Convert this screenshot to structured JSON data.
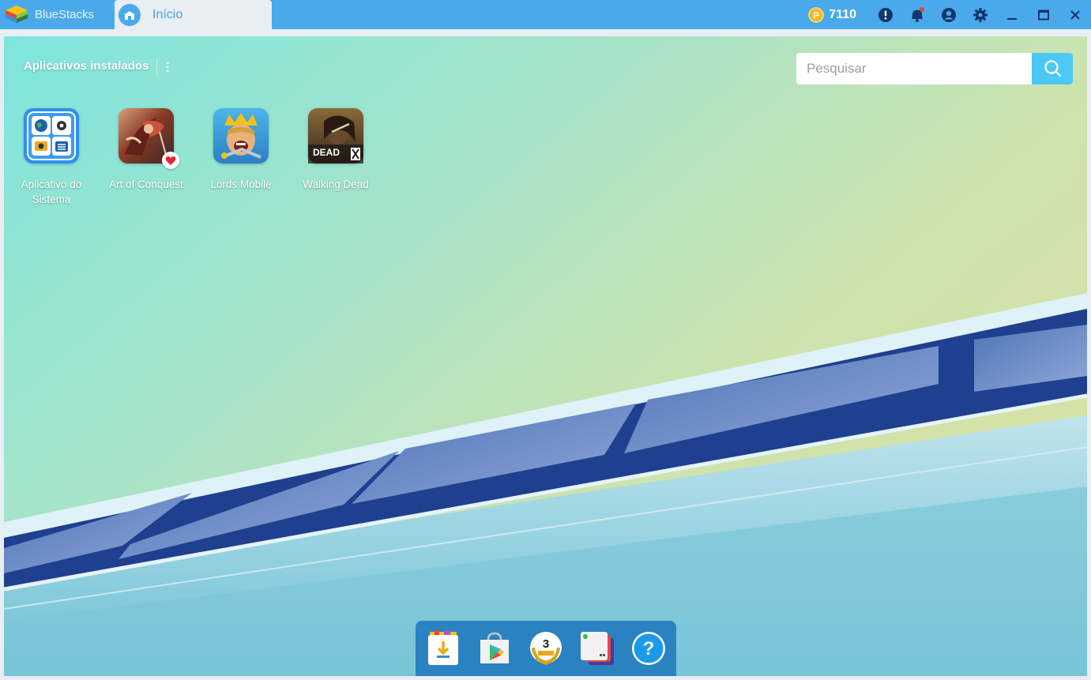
{
  "titlebar": {
    "app_name": "BlueStacks",
    "tab_label": "Início",
    "coins": "7110",
    "colors": {
      "bar": "#4aa9ea",
      "tab_bg": "#e8eef3",
      "coin": "#f5b820"
    }
  },
  "header": {
    "title": "Aplicativos instalados",
    "search_placeholder": "Pesquisar"
  },
  "apps": [
    {
      "label": "Aplicativo do Sistema",
      "icon": "system-apps-icon"
    },
    {
      "label": "Art of Conquest",
      "icon": "art-of-conquest-icon",
      "badge": "heart-icon"
    },
    {
      "label": "Lords Mobile",
      "icon": "lords-mobile-icon"
    },
    {
      "label": "Walking Dead",
      "icon": "walking-dead-icon",
      "art_text": "DEAD"
    }
  ],
  "dock": {
    "items": [
      "download-app-icon",
      "play-store-icon",
      "anniversary-icon",
      "multi-instance-icon",
      "help-icon"
    ],
    "anniversary_number": "3",
    "help_glyph": "?"
  }
}
